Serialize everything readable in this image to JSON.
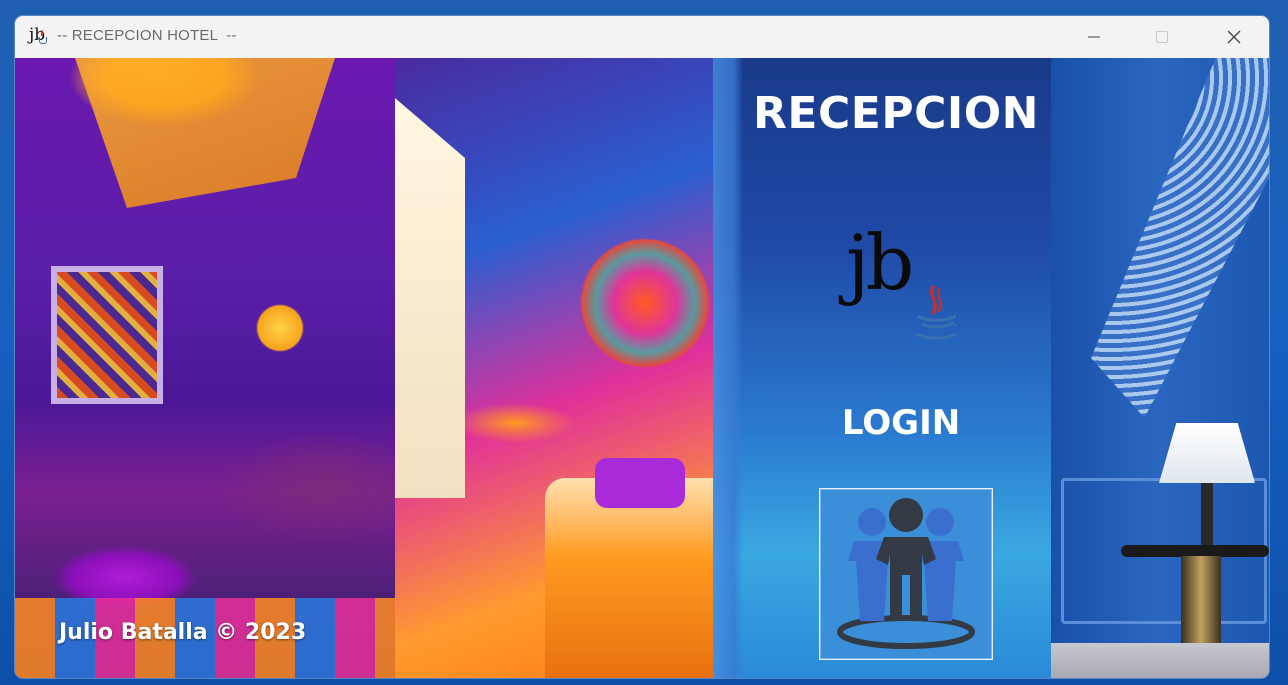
{
  "window": {
    "title": "-- RECEPCION HOTEL  --",
    "controls": {
      "minimize": "minimize-icon",
      "maximize": "maximize-icon",
      "close": "close-icon"
    }
  },
  "app_icon": {
    "text": "jb",
    "icon": "java-cup-icon"
  },
  "main": {
    "heading": "RECEPCION",
    "logo_text": "jb",
    "login_label": "LOGIN",
    "login_button_icon": "users-group-icon",
    "credit": "Julio Batalla © 2023"
  },
  "colors": {
    "panel_top": "#1a3a8a",
    "panel_bottom": "#3aa8e0",
    "login_button_bg": "#3a8fd8",
    "users_icon_dark": "#333a44",
    "users_icon_blue": "#3a6fd0"
  }
}
